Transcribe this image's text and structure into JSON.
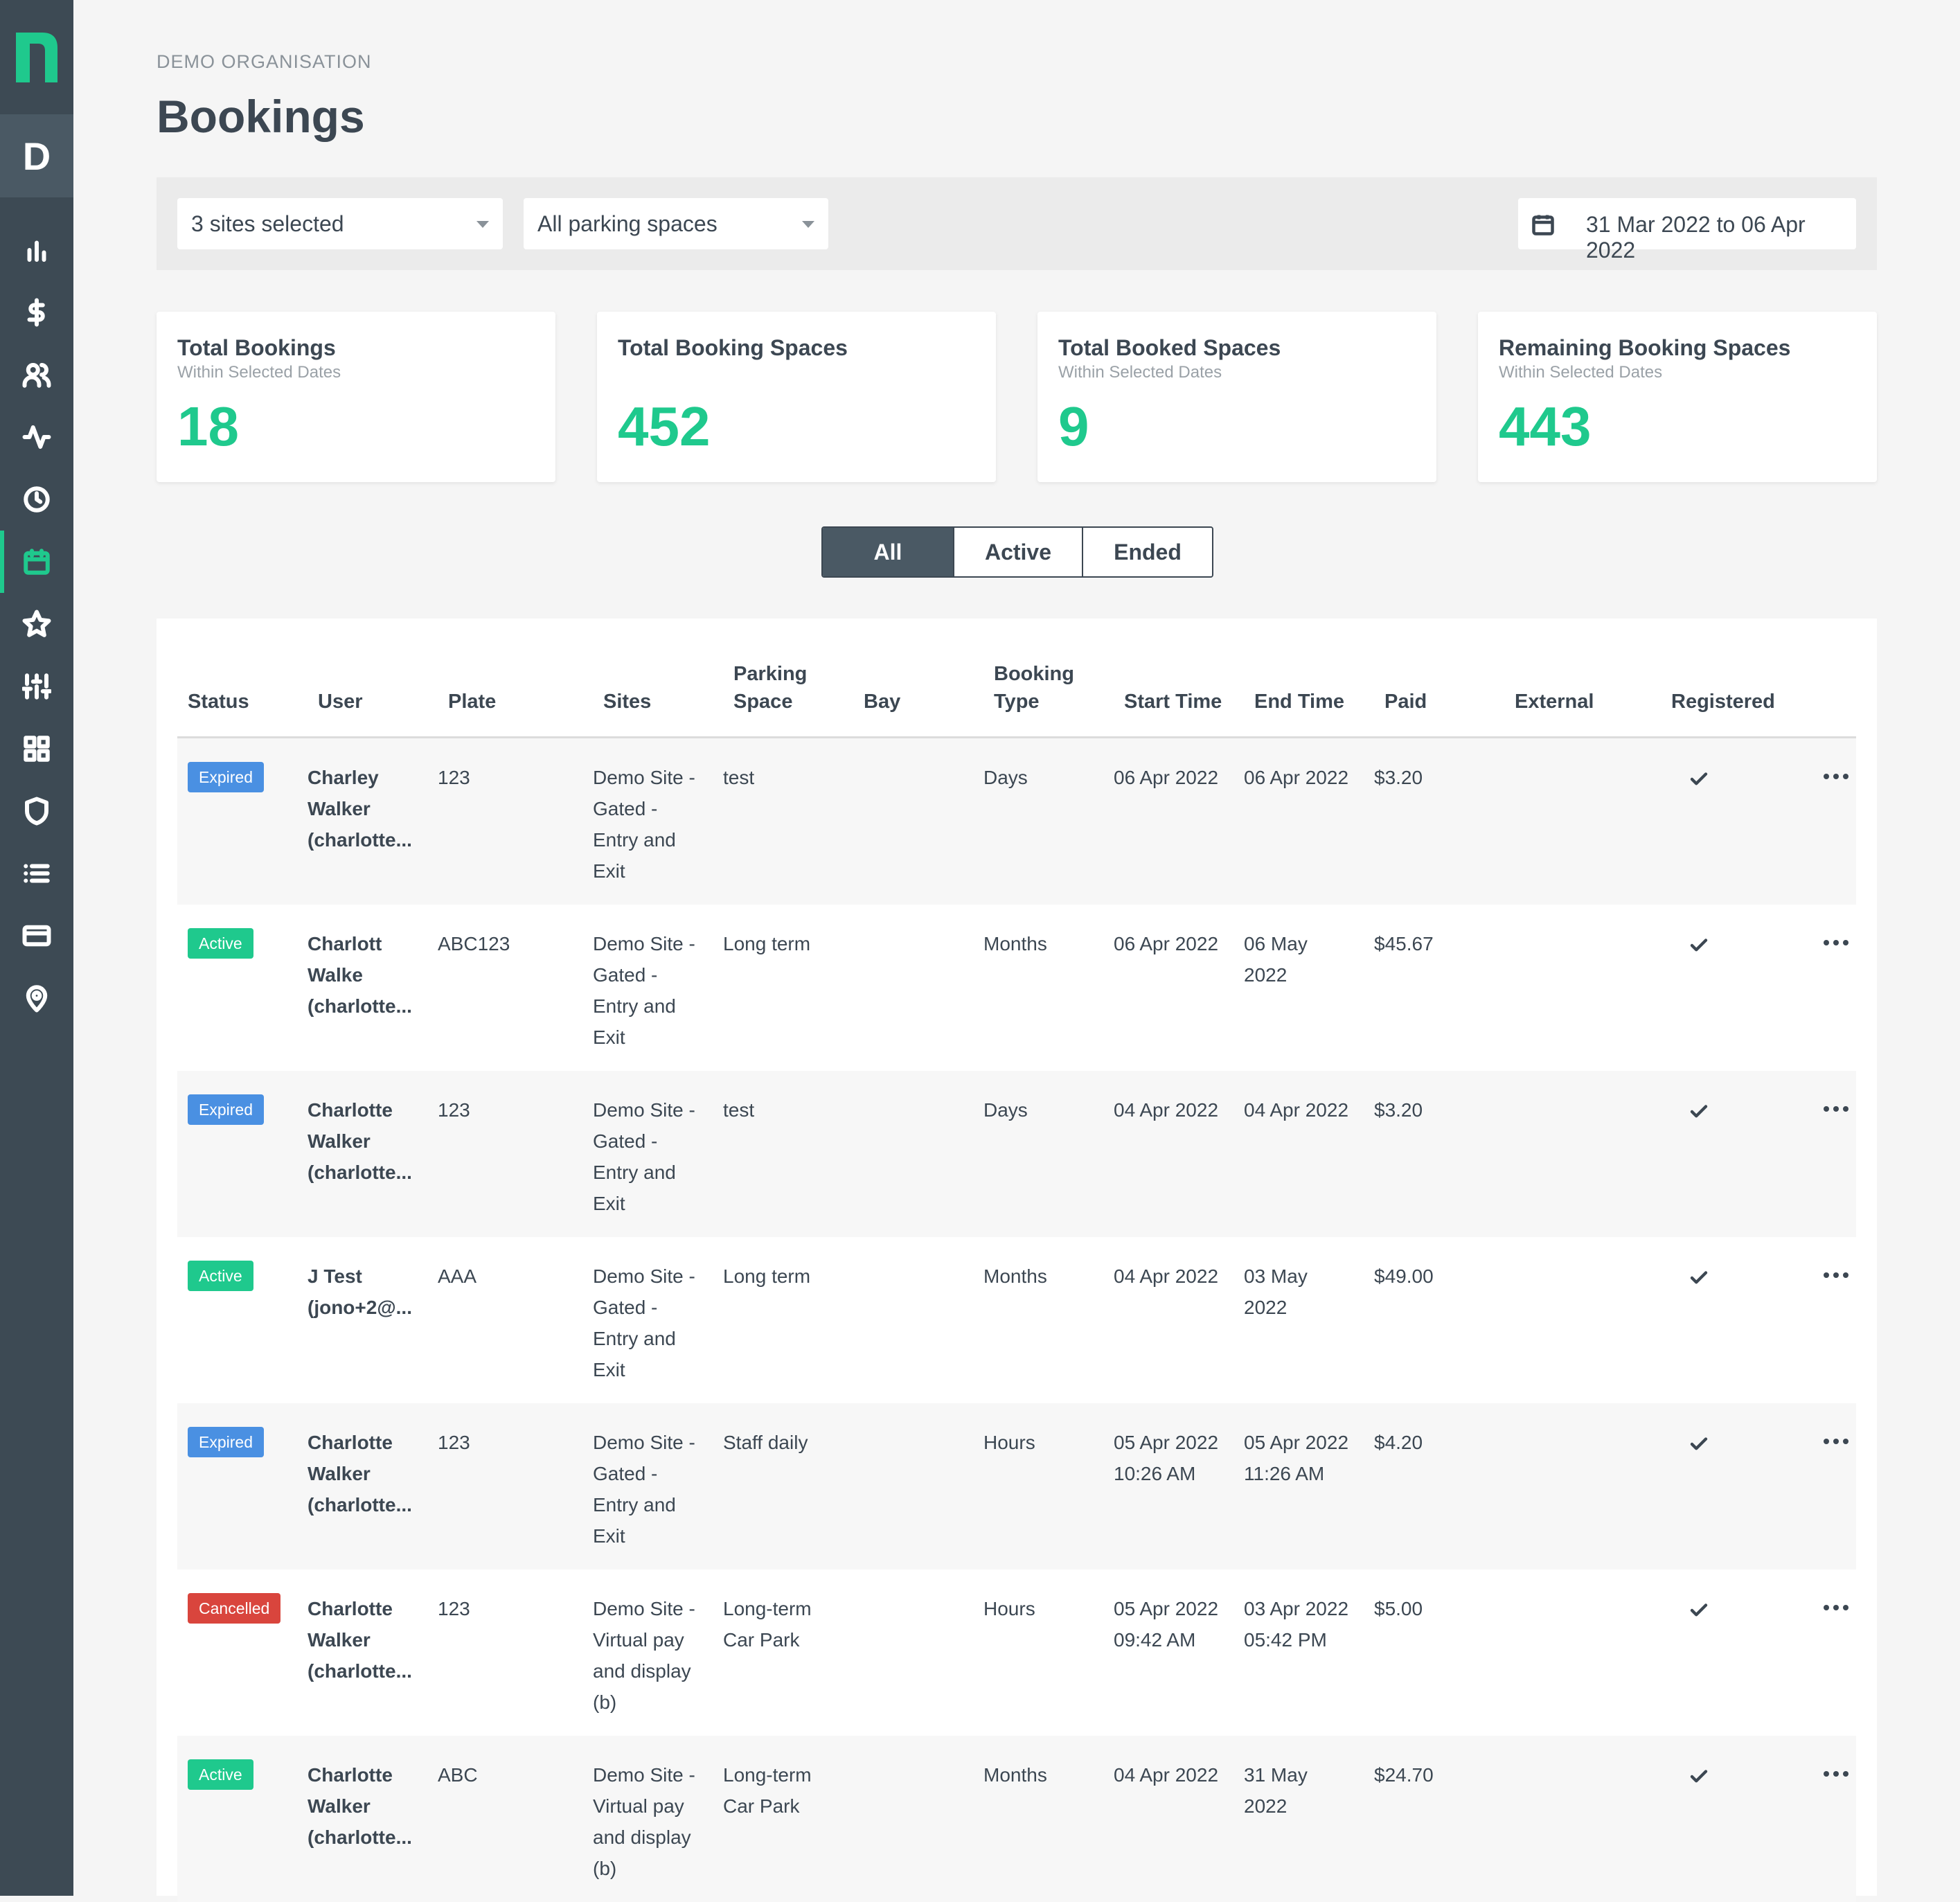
{
  "org_badge": "D",
  "org_name": "DEMO ORGANISATION",
  "page_title": "Bookings",
  "colors": {
    "sidebar": "#3d4a54",
    "accent": "#1fc98d",
    "expired": "#4a90e2",
    "active": "#1fc98d",
    "cancelled": "#d9453d"
  },
  "nav": [
    "analytics-icon",
    "dollar-icon",
    "users-icon",
    "activity-icon",
    "clock-icon",
    "calendar-icon",
    "star-icon",
    "sliders-icon",
    "grid-icon",
    "shield-icon",
    "list-icon",
    "credit-card-icon",
    "location-pin-icon"
  ],
  "filters": {
    "sites": "3 sites selected",
    "parking": "All parking spaces",
    "date_range": "31 Mar 2022 to 06 Apr 2022"
  },
  "stats": [
    {
      "title": "Total Bookings",
      "sub": "Within Selected Dates",
      "value": "18"
    },
    {
      "title": "Total Booking Spaces",
      "sub": "",
      "value": "452"
    },
    {
      "title": "Total Booked Spaces",
      "sub": "Within Selected Dates",
      "value": "9"
    },
    {
      "title": "Remaining Booking Spaces",
      "sub": "Within Selected Dates",
      "value": "443"
    }
  ],
  "tabs": {
    "all": "All",
    "active": "Active",
    "ended": "Ended"
  },
  "headers": {
    "status": "Status",
    "user": "User",
    "plate": "Plate",
    "sites": "Sites",
    "parking_space_1": "Parking",
    "parking_space_2": "Space",
    "bay": "Bay",
    "booking_type_1": "Booking",
    "booking_type_2": "Type",
    "start": "Start Time",
    "end": "End Time",
    "paid": "Paid",
    "external": "External",
    "registered": "Registered"
  },
  "rows": [
    {
      "status": "Expired",
      "user1": "Charley",
      "user2": "Walker",
      "user3": "(charlotte...",
      "plate": "123",
      "site1": "Demo Site -",
      "site2": "Gated -",
      "site3": "Entry and",
      "site4": "Exit",
      "space1": "test",
      "space2": "",
      "type": "Days",
      "start1": "06 Apr 2022",
      "start2": "",
      "end1": "06 Apr 2022",
      "end2": "",
      "paid": "$3.20"
    },
    {
      "status": "Active",
      "user1": "Charlott",
      "user2": "Walke",
      "user3": "(charlotte...",
      "plate": "ABC123",
      "site1": "Demo Site -",
      "site2": "Gated -",
      "site3": "Entry and",
      "site4": "Exit",
      "space1": "Long term",
      "space2": "",
      "type": "Months",
      "start1": "06 Apr 2022",
      "start2": "",
      "end1": "06 May",
      "end2": "2022",
      "paid": "$45.67"
    },
    {
      "status": "Expired",
      "user1": "Charlotte",
      "user2": "Walker",
      "user3": "(charlotte...",
      "plate": "123",
      "site1": "Demo Site -",
      "site2": "Gated -",
      "site3": "Entry and",
      "site4": "Exit",
      "space1": "test",
      "space2": "",
      "type": "Days",
      "start1": "04 Apr 2022",
      "start2": "",
      "end1": "04 Apr 2022",
      "end2": "",
      "paid": "$3.20"
    },
    {
      "status": "Active",
      "user1": "J Test",
      "user2": "(jono+2@...",
      "user3": "",
      "plate": "AAA",
      "site1": "Demo Site -",
      "site2": "Gated -",
      "site3": "Entry and",
      "site4": "Exit",
      "space1": "Long term",
      "space2": "",
      "type": "Months",
      "start1": "04 Apr 2022",
      "start2": "",
      "end1": "03 May",
      "end2": "2022",
      "paid": "$49.00"
    },
    {
      "status": "Expired",
      "user1": "Charlotte",
      "user2": "Walker",
      "user3": "(charlotte...",
      "plate": "123",
      "site1": "Demo Site -",
      "site2": "Gated -",
      "site3": "Entry and",
      "site4": "Exit",
      "space1": "Staff daily",
      "space2": "",
      "type": "Hours",
      "start1": "05 Apr 2022",
      "start2": "10:26 AM",
      "end1": "05 Apr 2022",
      "end2": "11:26 AM",
      "paid": "$4.20"
    },
    {
      "status": "Cancelled",
      "user1": "Charlotte",
      "user2": "Walker",
      "user3": "(charlotte...",
      "plate": "123",
      "site1": "Demo Site -",
      "site2": "Virtual pay",
      "site3": "and display",
      "site4": "(b)",
      "space1": "Long-term",
      "space2": "Car Park",
      "type": "Hours",
      "start1": "05 Apr 2022",
      "start2": "09:42 AM",
      "end1": "03 Apr 2022",
      "end2": "05:42 PM",
      "paid": "$5.00"
    },
    {
      "status": "Active",
      "user1": "Charlotte",
      "user2": "Walker",
      "user3": "(charlotte...",
      "plate": "ABC",
      "site1": "Demo Site -",
      "site2": "Virtual pay",
      "site3": "and display",
      "site4": "(b)",
      "space1": "Long-term",
      "space2": "Car Park",
      "type": "Months",
      "start1": "04 Apr 2022",
      "start2": "",
      "end1": "31 May",
      "end2": "2022",
      "paid": "$24.70"
    }
  ]
}
